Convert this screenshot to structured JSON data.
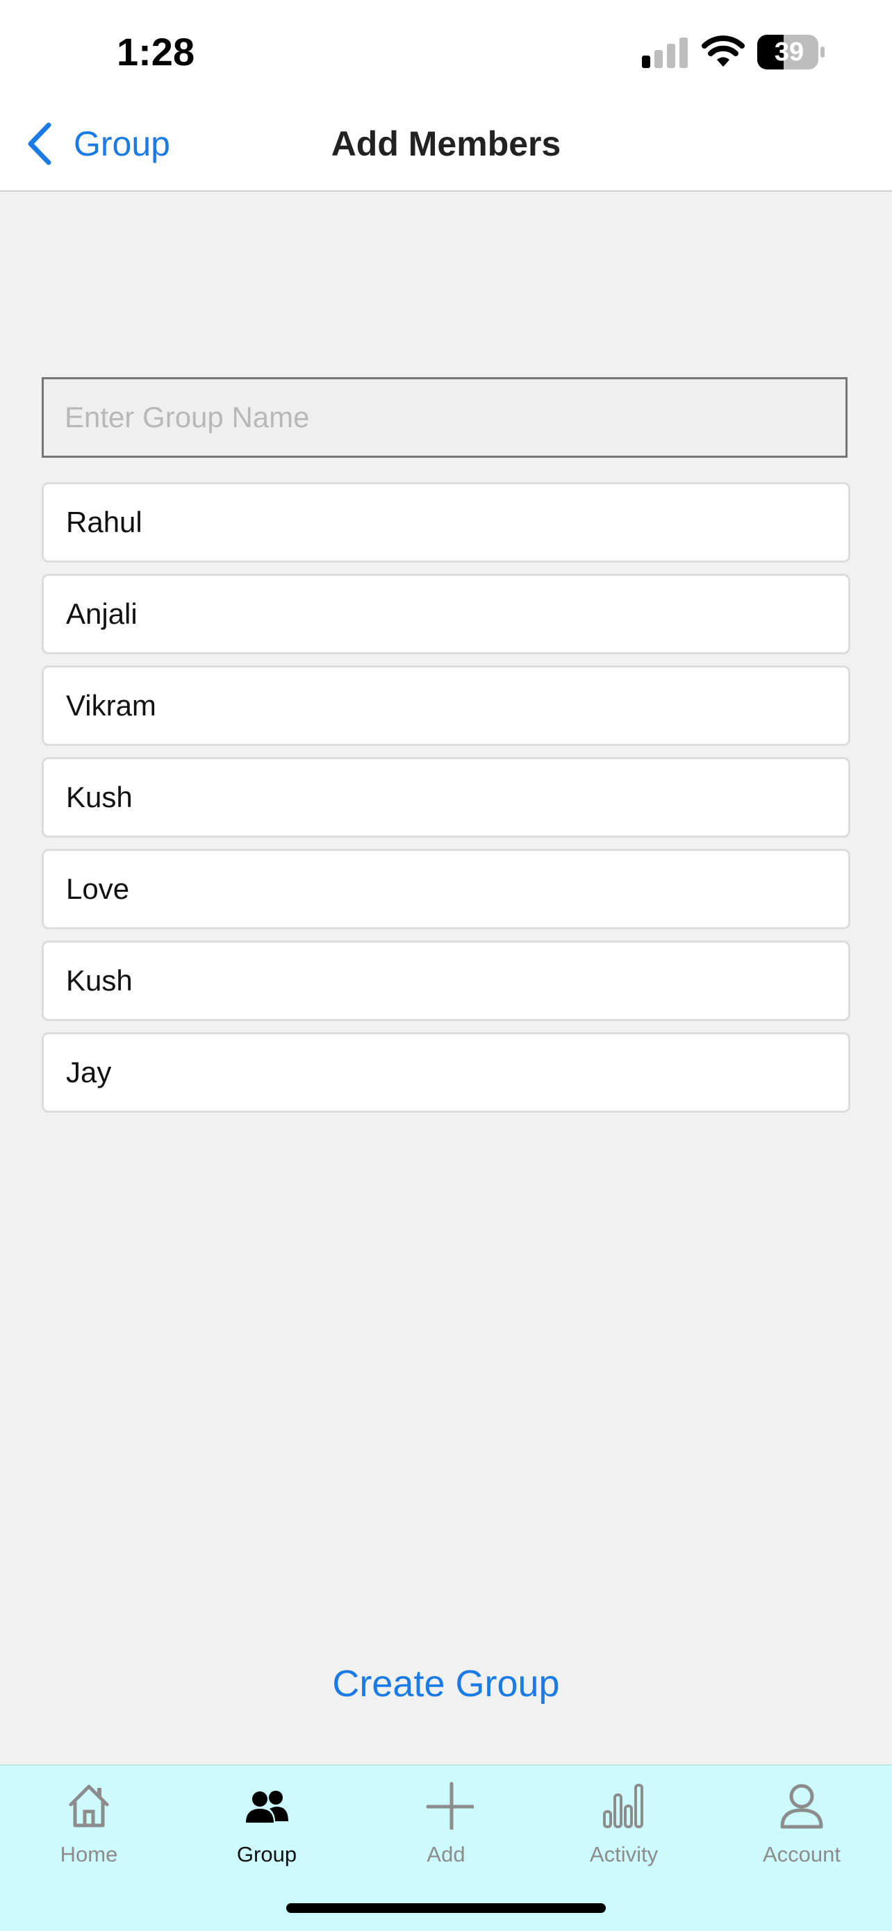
{
  "status_bar": {
    "time": "1:28",
    "battery_level": "39",
    "icons": [
      "cellular-signal-icon",
      "wifi-icon",
      "battery-icon"
    ]
  },
  "nav": {
    "back_label": "Group",
    "title": "Add Members",
    "accent_color": "#1a7ae6"
  },
  "form": {
    "group_name_placeholder": "Enter Group Name",
    "group_name_value": ""
  },
  "members": [
    {
      "name": "Rahul"
    },
    {
      "name": "Anjali"
    },
    {
      "name": "Vikram"
    },
    {
      "name": "Kush"
    },
    {
      "name": "Love"
    },
    {
      "name": "Kush"
    },
    {
      "name": "Jay"
    }
  ],
  "actions": {
    "create_group_label": "Create Group"
  },
  "tab_bar": {
    "background_color": "#cdfafd",
    "active_tab": "Group",
    "tabs": [
      {
        "label": "Home",
        "icon": "home-icon"
      },
      {
        "label": "Group",
        "icon": "group-icon"
      },
      {
        "label": "Add",
        "icon": "add-icon"
      },
      {
        "label": "Activity",
        "icon": "activity-icon"
      },
      {
        "label": "Account",
        "icon": "account-icon"
      }
    ]
  }
}
